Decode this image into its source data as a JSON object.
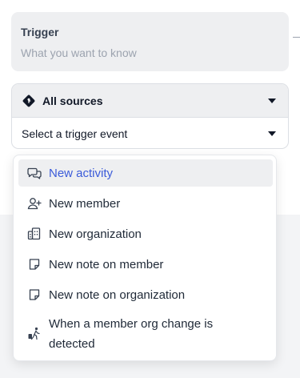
{
  "trigger": {
    "title": "Trigger",
    "subtitle": "What you want to know"
  },
  "source_select": {
    "label": "All sources",
    "icon": "diamond-source-icon"
  },
  "event_select": {
    "label": "Select a trigger event"
  },
  "menu": {
    "items": [
      {
        "label": "New activity",
        "icon": "chat-bubbles-icon",
        "active": true
      },
      {
        "label": "New member",
        "icon": "user-plus-icon",
        "active": false
      },
      {
        "label": "New organization",
        "icon": "building-icon",
        "active": false
      },
      {
        "label": "New note on member",
        "icon": "note-icon",
        "active": false
      },
      {
        "label": "New note on organization",
        "icon": "note-icon",
        "active": false
      },
      {
        "label": "When a member org change is detected",
        "icon": "person-walking-luggage-icon",
        "active": false
      }
    ]
  },
  "colors": {
    "active_text": "#3b5bd9",
    "active_bg": "#eeeff1",
    "card_bg": "#eeeff1"
  }
}
